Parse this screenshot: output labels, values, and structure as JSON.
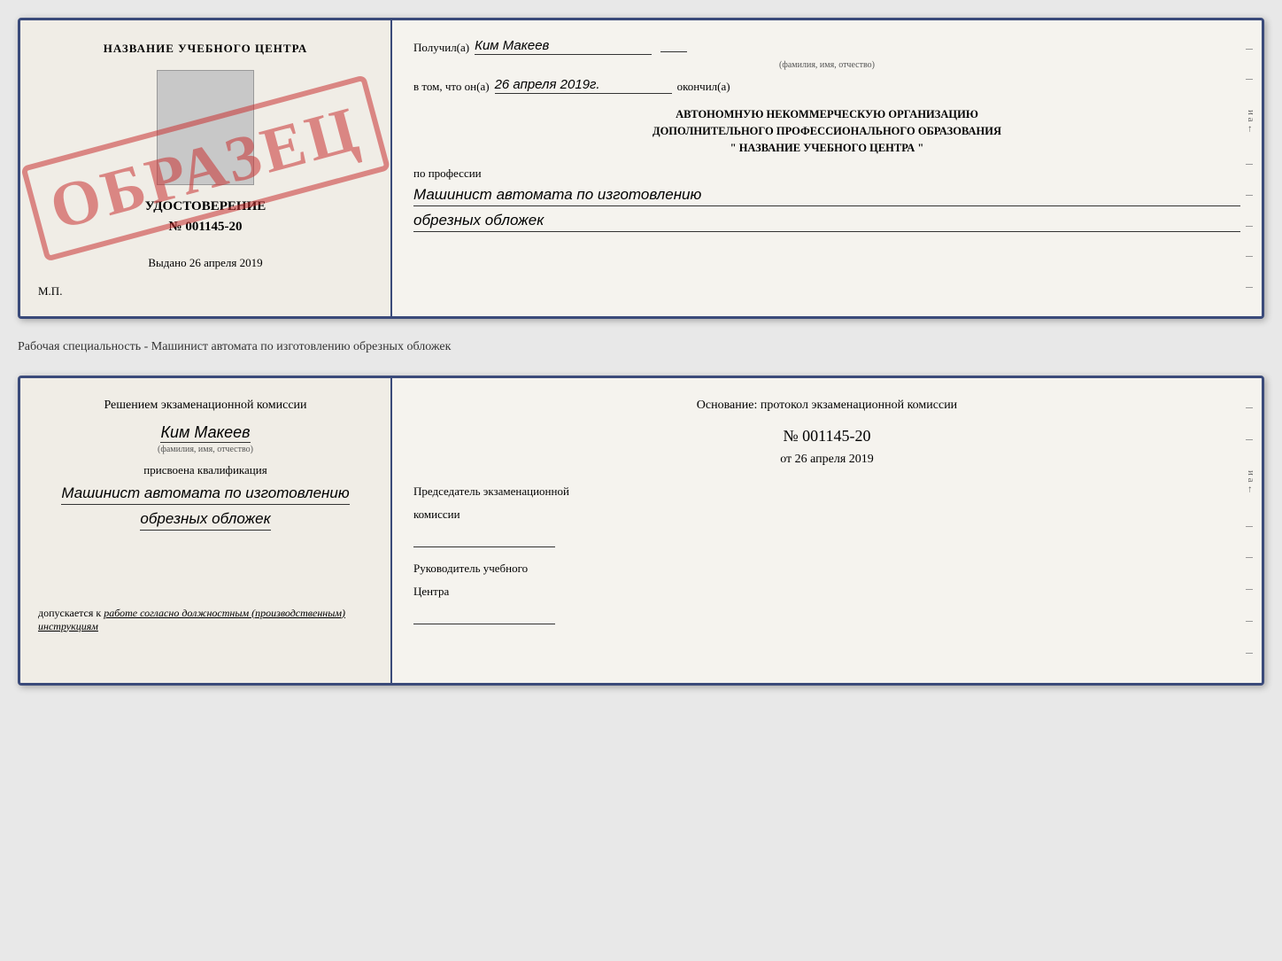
{
  "top_document": {
    "left": {
      "school_title": "НАЗВАНИЕ УЧЕБНОГО ЦЕНТРА",
      "stamp_text": "ОБРАЗЕЦ",
      "cert_title": "УДОСТОВЕРЕНИЕ",
      "cert_number": "№ 001145-20",
      "issued_label": "Выдано",
      "issued_date": "26 апреля 2019",
      "mp_label": "М.П."
    },
    "right": {
      "received_label": "Получил(а)",
      "person_name": "Ким Макеев",
      "person_sub": "(фамилия, имя, отчество)",
      "in_that_label": "в том, что он(а)",
      "date_value": "26 апреля 2019г.",
      "finished_label": "окончил(а)",
      "org_line1": "АВТОНОМНУЮ НЕКОММЕРЧЕСКУЮ ОРГАНИЗАЦИЮ",
      "org_line2": "ДОПОЛНИТЕЛЬНОГО ПРОФЕССИОНАЛЬНОГО ОБРАЗОВАНИЯ",
      "org_line3": "\"  НАЗВАНИЕ УЧЕБНОГО ЦЕНТРА  \"",
      "profession_label": "по профессии",
      "profession_line1": "Машинист автомата по изготовлению",
      "profession_line2": "обрезных обложек"
    }
  },
  "specialty_text": "Рабочая специальность - Машинист автомата по изготовлению обрезных обложек",
  "bottom_document": {
    "left": {
      "commission_line1": "Решением экзаменационной комиссии",
      "person_name": "Ким Макеев",
      "person_sub": "(фамилия, имя, отчество)",
      "qualification_label": "присвоена квалификация",
      "qualification_line1": "Машинист автомата по изготовлению",
      "qualification_line2": "обрезных обложек",
      "admission_text": "допускается к",
      "admission_italic": "работе согласно должностным (производственным) инструкциям"
    },
    "right": {
      "basis_label": "Основание: протокол экзаменационной комиссии",
      "protocol_number": "№  001145-20",
      "date_label": "от",
      "date_value": "26 апреля 2019",
      "chairman_line1": "Председатель экзаменационной",
      "chairman_line2": "комиссии",
      "head_line1": "Руководитель учебного",
      "head_line2": "Центра"
    }
  },
  "side_labels": {
    "letters": [
      "и",
      "а",
      "←",
      "–",
      "–",
      "–",
      "–",
      "–"
    ]
  }
}
